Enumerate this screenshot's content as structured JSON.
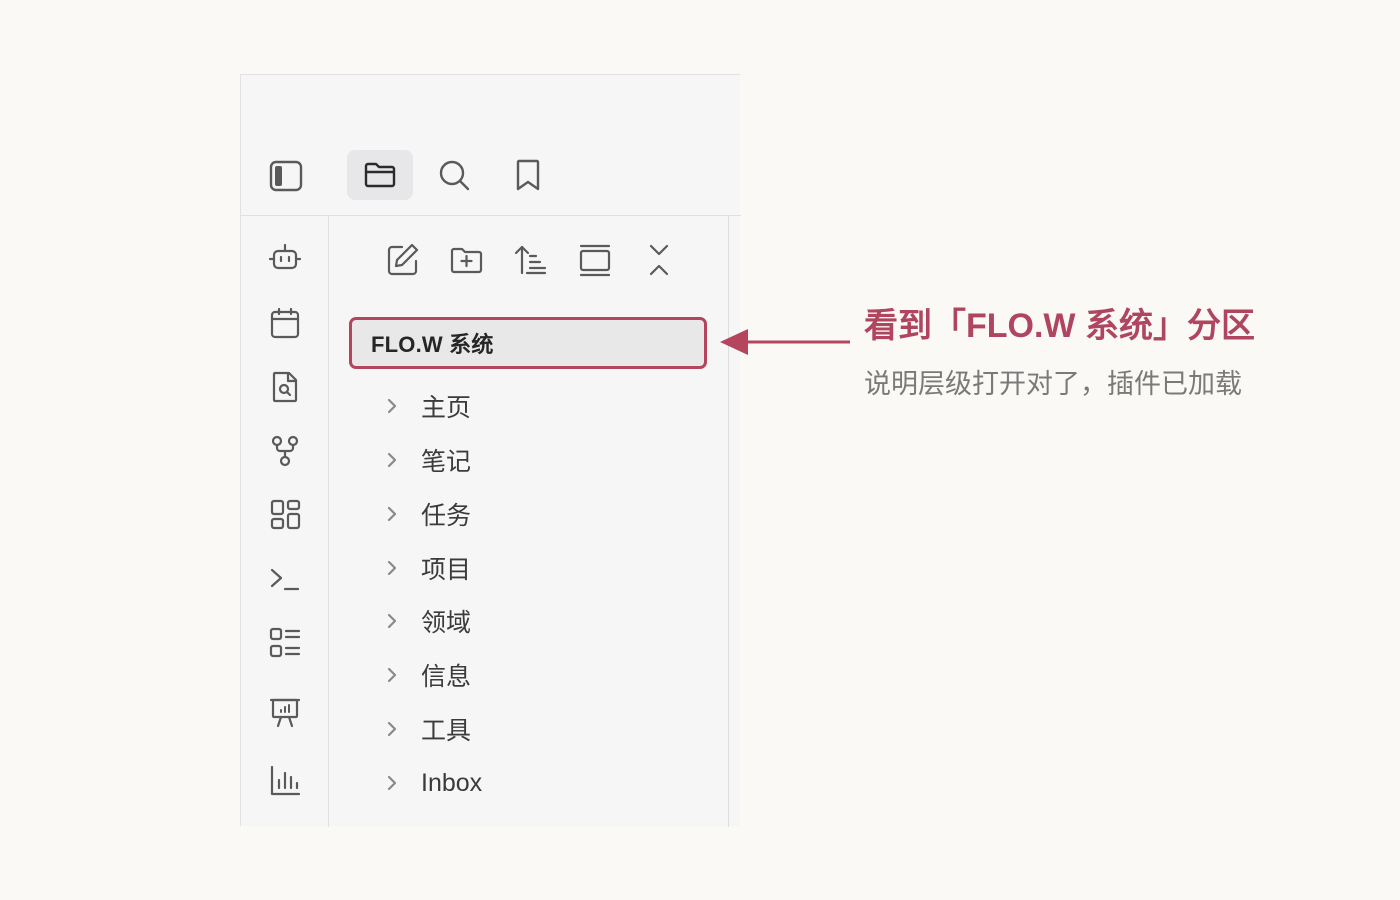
{
  "colors": {
    "accent": "#b5445d",
    "callout_title": "#b04560",
    "callout_sub": "#7a7a7a",
    "icon": "#5a5a5a",
    "panel_bg": "#f6f6f7",
    "page_bg": "#faf9f5"
  },
  "top_tabs": [
    {
      "icon": "sidebar-toggle-icon",
      "active": false
    },
    {
      "icon": "folder-icon",
      "active": true
    },
    {
      "icon": "search-icon",
      "active": false
    },
    {
      "icon": "bookmark-icon",
      "active": false
    }
  ],
  "ribbon": {
    "icons": [
      "bot-icon",
      "calendar-icon",
      "file-search-icon",
      "graph-icon",
      "layout-grid-icon",
      "terminal-icon",
      "list-icon",
      "presentation-icon",
      "bar-chart-icon"
    ]
  },
  "explorer": {
    "toolbar": [
      "new-note-icon",
      "new-folder-icon",
      "sort-icon",
      "collapse-view-icon",
      "collapse-all-icon"
    ],
    "vault_name": "FLO.W 系统",
    "items": [
      {
        "label": "主页"
      },
      {
        "label": "笔记"
      },
      {
        "label": "任务"
      },
      {
        "label": "项目"
      },
      {
        "label": "领域"
      },
      {
        "label": "信息"
      },
      {
        "label": "工具"
      },
      {
        "label": "Inbox"
      }
    ]
  },
  "callout": {
    "title": "看到「FLO.W 系统」分区",
    "subtitle": "说明层级打开对了，插件已加载"
  }
}
